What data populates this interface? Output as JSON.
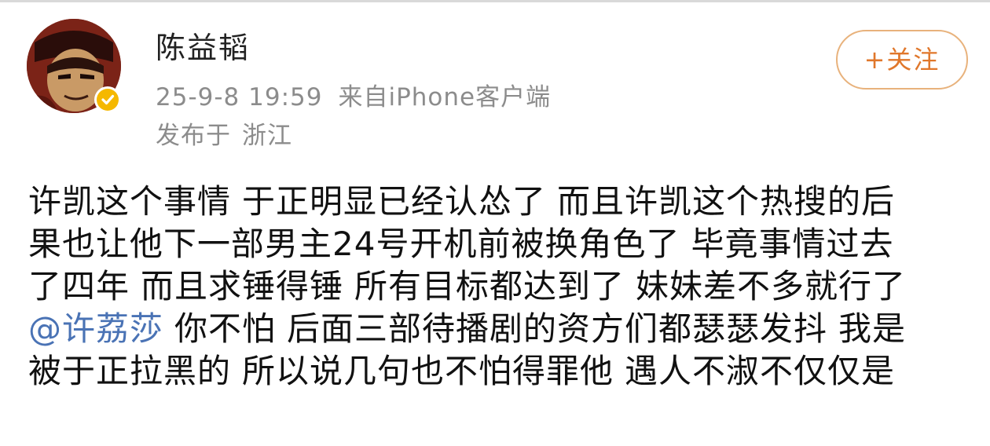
{
  "user": {
    "name": "陈益韬",
    "post_time": "25-9-8 19:59",
    "source": "来自iPhone客户端",
    "location_prefix": "发布于",
    "location": "浙江"
  },
  "actions": {
    "follow_label": "+关注"
  },
  "post": {
    "lines": [
      [
        "许凯这个事情",
        "于正明显已经认怂了",
        "而且许凯这个热搜的后"
      ],
      [
        "果也让他下一部男主24号开机前被换角色了",
        "毕竟事情过去"
      ],
      [
        "了四年",
        "而且求锤得锤",
        "所有目标都达到了",
        "妹妹差不多就行了"
      ],
      [
        "你不怕",
        "后面三部待播剧的资方们都瑟瑟发抖",
        "我是"
      ],
      [
        "被于正拉黑的",
        "所以说几句也不怕得罪他",
        "遇人不淑不仅仅是"
      ]
    ],
    "mention": "@许荔莎"
  },
  "colors": {
    "follow_accent": "#e0772b",
    "mention": "#4a73b5",
    "meta_text": "#8c8c8c",
    "verified_badge": "#f5b800"
  },
  "icons": {
    "avatar": "avatar",
    "verified": "verified-badge-icon"
  }
}
